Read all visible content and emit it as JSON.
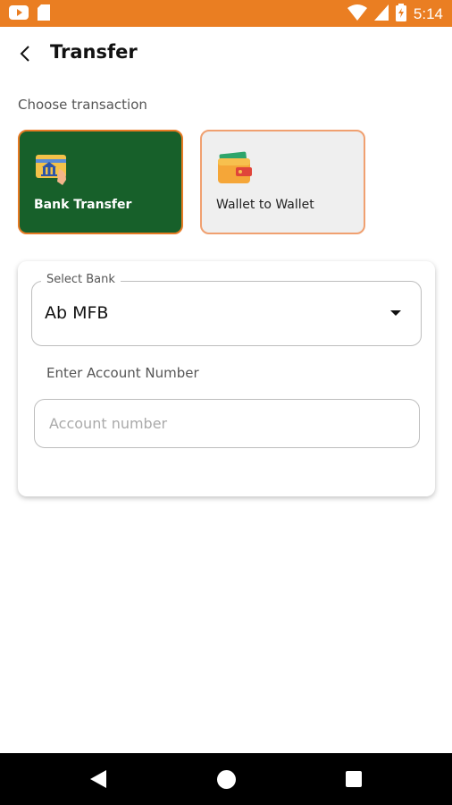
{
  "status_bar": {
    "time": "5:14",
    "icons": [
      "youtube-icon",
      "sd-card-icon",
      "wifi-icon",
      "signal-icon",
      "battery-icon"
    ],
    "background": "#ea7e22"
  },
  "header": {
    "title": "Transfer",
    "back_icon": "chevron-left-icon"
  },
  "transaction": {
    "section_label": "Choose transaction",
    "options": [
      {
        "label": "Bank Transfer",
        "icon": "bank-transfer-icon",
        "selected": true,
        "background": "#17602a"
      },
      {
        "label": "Wallet to Wallet",
        "icon": "wallet-icon",
        "selected": false,
        "background": "#efefef"
      }
    ]
  },
  "form": {
    "bank_select": {
      "label": "Select Bank",
      "value": "Ab MFB"
    },
    "account": {
      "label": "Enter Account Number",
      "placeholder": "Account number",
      "value": ""
    }
  },
  "nav_bar": {
    "icons": [
      "back-icon",
      "home-icon",
      "recents-icon"
    ]
  },
  "colors": {
    "accent": "#ea7e22",
    "brand_green": "#17602a"
  }
}
